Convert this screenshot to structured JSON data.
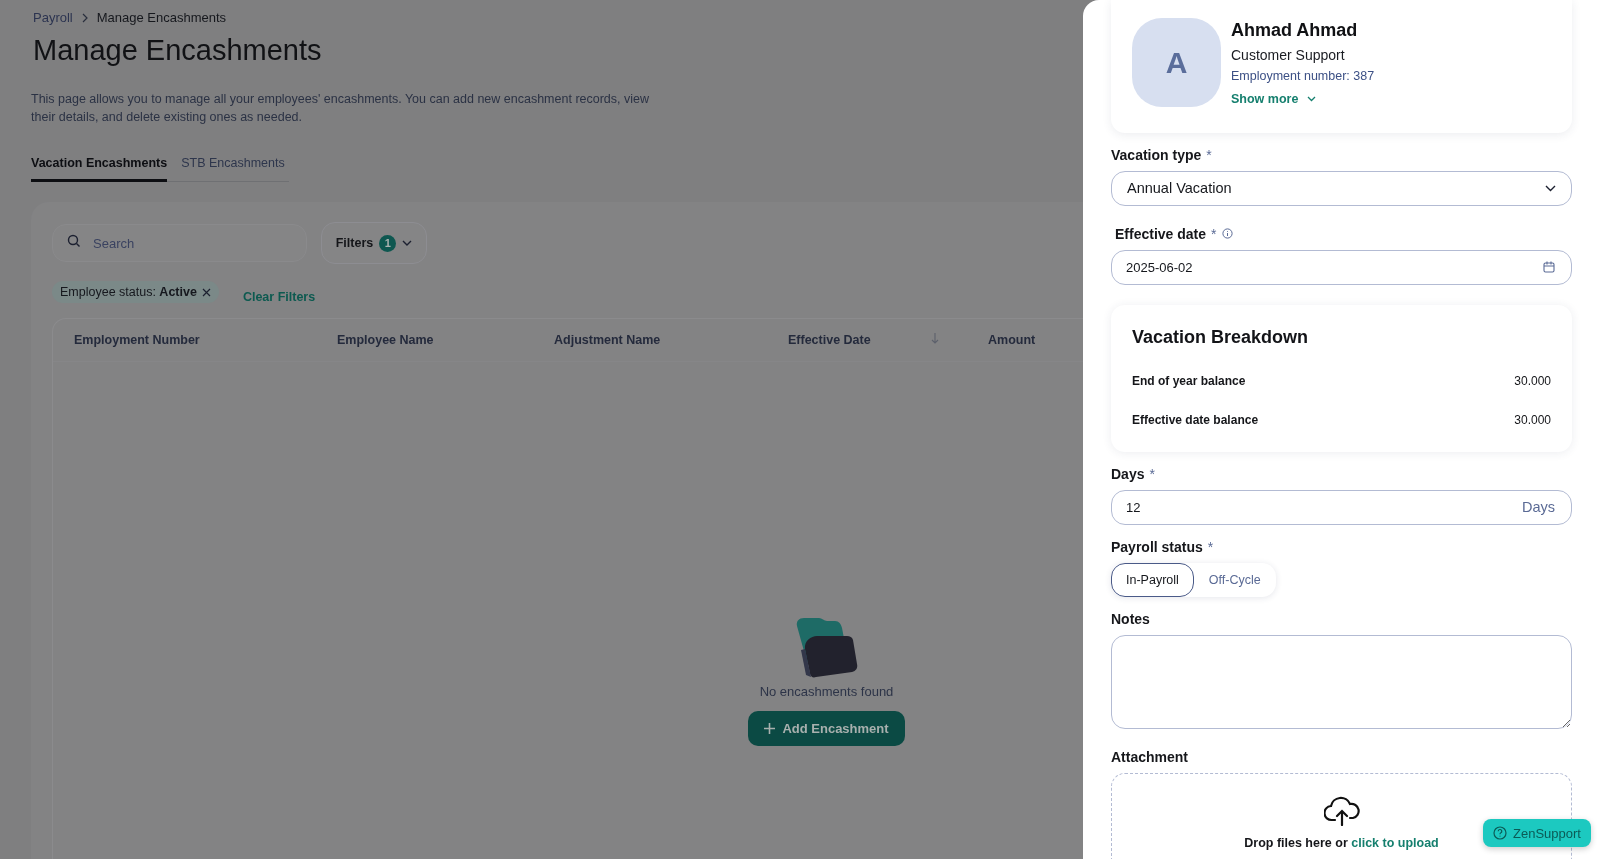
{
  "breadcrumb": [
    {
      "label": "Payroll",
      "current": false
    },
    {
      "label": "Manage Encashments",
      "current": true
    }
  ],
  "page_title": "Manage Encashments",
  "description": "This page allows you to manage all your employees' encashments. You can add new encashment records, view their details, and delete existing ones as needed.",
  "tabs": [
    {
      "label": "Vacation Encashments",
      "selected": true
    },
    {
      "label": "STB Encashments",
      "selected": false
    }
  ],
  "search": {
    "placeholder": "Search"
  },
  "filters": {
    "label": "Filters",
    "count": "1"
  },
  "active_filters": [
    {
      "text": "Employee status: **Active**"
    }
  ],
  "clear_filters": "Clear Filters",
  "table": {
    "columns": [
      {
        "label": "Employment Number",
        "sorted": false
      },
      {
        "label": "Employee Name",
        "sorted": false
      },
      {
        "label": "Adjustment Name",
        "sorted": false
      },
      {
        "label": "Effective Date",
        "sorted": true
      },
      {
        "label": "Amount",
        "sorted": false
      }
    ]
  },
  "empty_state": {
    "message": "No encashments found",
    "button": "Add Encashment"
  },
  "panel": {
    "employee": {
      "initial": "A",
      "name": "Ahmad Ahmad",
      "department": "Customer Support",
      "employment_number": "Employment number: 387",
      "show_more": "Show more"
    },
    "vacation_type": {
      "label": "Vacation type",
      "required_mark": "*",
      "value": "Annual Vacation"
    },
    "effective_date": {
      "label": "Effective date",
      "required_mark": "*",
      "value": "2025-06-02"
    },
    "breakdown": {
      "title": "Vacation Breakdown",
      "rows": [
        {
          "label": "End of year balance",
          "value": "30.000"
        },
        {
          "label": "Effective date balance",
          "value": "30.000"
        }
      ]
    },
    "days": {
      "label": "Days",
      "required_mark": "*",
      "value": "12",
      "unit": "Days"
    },
    "payroll_status": {
      "label": "Payroll status",
      "required_mark": "*",
      "options": [
        {
          "label": "In-Payroll",
          "selected": true
        },
        {
          "label": "Off-Cycle",
          "selected": false
        }
      ]
    },
    "notes": {
      "label": "Notes"
    },
    "attachment": {
      "label": "Attachment",
      "prompt": "Drop files here or",
      "link": "click to upload"
    }
  },
  "support_button": "ZenSupport"
}
